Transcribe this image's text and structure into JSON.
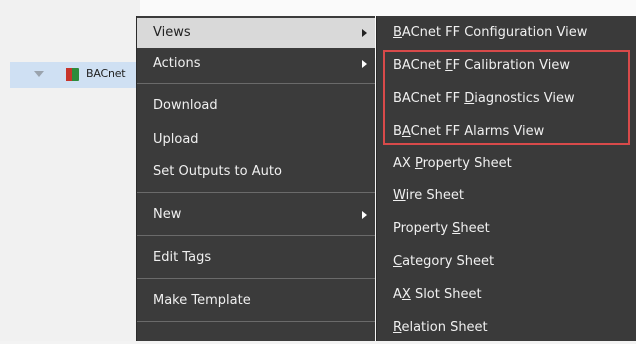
{
  "tree": {
    "node_label": "BACnet"
  },
  "context_menu": {
    "items": [
      {
        "label": "Views",
        "has_submenu": true,
        "active": true
      },
      {
        "label": "Actions",
        "has_submenu": true,
        "active": false
      },
      {
        "label": "Download",
        "has_submenu": false,
        "active": false
      },
      {
        "label": "Upload",
        "has_submenu": false,
        "active": false
      },
      {
        "label": "Set Outputs to Auto",
        "has_submenu": false,
        "active": false
      },
      {
        "label": "New",
        "has_submenu": true,
        "active": false
      },
      {
        "label": "Edit Tags",
        "has_submenu": false,
        "active": false
      },
      {
        "label": "Make Template",
        "has_submenu": false,
        "active": false
      }
    ]
  },
  "views_submenu": {
    "items": [
      {
        "before": "",
        "mnemonic": "B",
        "after": "ACnet FF Configuration View"
      },
      {
        "before": "BACnet ",
        "mnemonic": "F",
        "after": "F Calibration View"
      },
      {
        "before": "BACnet FF ",
        "mnemonic": "D",
        "after": "iagnostics View"
      },
      {
        "before": "B",
        "mnemonic": "A",
        "after": "Cnet FF Alarms View"
      },
      {
        "before": "AX ",
        "mnemonic": "P",
        "after": "roperty Sheet"
      },
      {
        "before": "",
        "mnemonic": "W",
        "after": "ire Sheet"
      },
      {
        "before": "Property ",
        "mnemonic": "S",
        "after": "heet"
      },
      {
        "before": "",
        "mnemonic": "C",
        "after": "ategory Sheet"
      },
      {
        "before": "A",
        "mnemonic": "X",
        "after": " Slot Sheet"
      },
      {
        "before": "",
        "mnemonic": "R",
        "after": "elation Sheet"
      }
    ]
  },
  "colors": {
    "menu_bg": "#3b3b3b",
    "menu_text": "#f0f0f0",
    "active_item_bg": "#d9d9d9",
    "highlight_border": "#d84a4a",
    "tree_selection": "#cfe0f3"
  }
}
